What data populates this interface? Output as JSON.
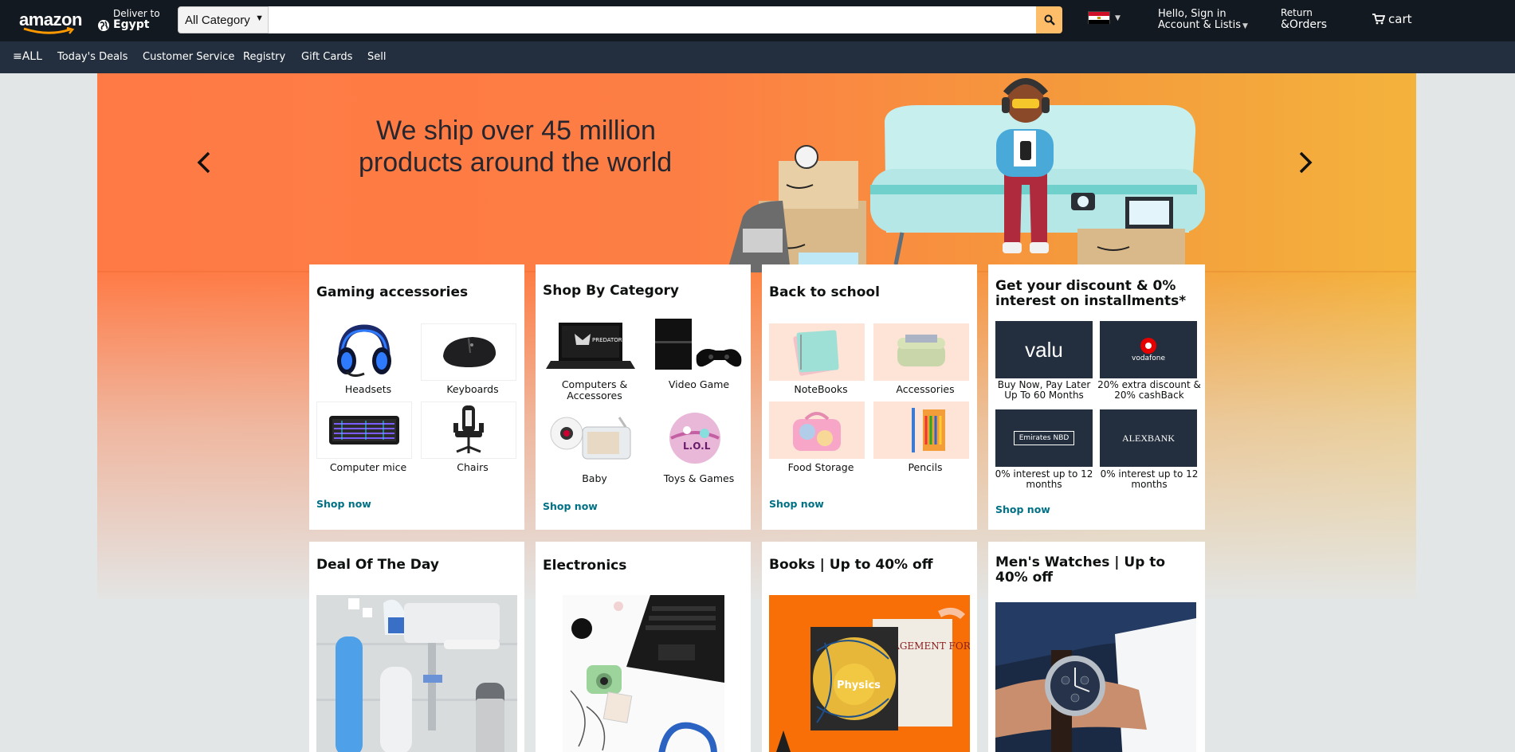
{
  "header": {
    "logo": "amazon",
    "deliver_line1": "Deliver to",
    "deliver_line2": "Egypt",
    "category": "All Category",
    "search_placeholder": "",
    "account_line1": "Hello, Sign in",
    "account_line2": "Account & Listis",
    "orders_line1": "Return",
    "orders_line2": "&Orders",
    "cart_label": "cart"
  },
  "subnav": {
    "all": "ALL",
    "items": [
      "Today's Deals",
      "Customer Service",
      "Registry",
      "Gift Cards",
      "Sell"
    ]
  },
  "hero": {
    "title_line1": "We ship over 45 million",
    "title_line2": "products around the world"
  },
  "cards": [
    {
      "title": "Gaming accessories",
      "tiles": [
        "Headsets",
        "Keyboards",
        "Computer mice",
        "Chairs"
      ],
      "link": "Shop now"
    },
    {
      "title": "Shop By Category",
      "tiles": [
        "Computers & Accessores",
        "Video Game",
        "Baby",
        "Toys & Games"
      ],
      "link": "Shop now"
    },
    {
      "title": "Back to school",
      "tiles": [
        "NoteBooks",
        "Accessories",
        "Food Storage",
        "Pencils"
      ],
      "link": "Shop now"
    },
    {
      "title": "Get your discount & 0% interest on installments*",
      "tiles": [
        "Buy Now, Pay Later Up To 60 Months",
        "20% extra discount & 20% cashBack",
        "0% interest up to 12 months",
        "0% interest up to 12 months"
      ],
      "logos": [
        "valu",
        "vodafone",
        "Emirates NBD",
        "ALEXBANK"
      ],
      "link": "Shop now"
    },
    {
      "title": "Deal Of The Day"
    },
    {
      "title": "Electronics"
    },
    {
      "title": "Books | Up to 40% off",
      "book_label": "Physics",
      "book2_label": "ANAGEMENT FORMATION SYSTEM"
    },
    {
      "title": "Men's Watches | Up to 40% off"
    }
  ],
  "colors": {
    "nav_top": "#131921",
    "nav_sub": "#232f3e",
    "search_button": "#febd69",
    "link": "#007185",
    "hero_left": "#ff7a45",
    "hero_right": "#f4b33c"
  }
}
